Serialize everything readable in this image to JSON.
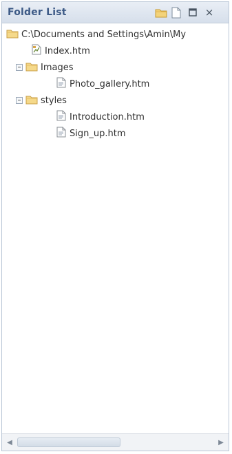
{
  "panel": {
    "title": "Folder List",
    "toolbar_icons": [
      "new-folder-icon",
      "new-page-icon",
      "maximize-icon",
      "close-icon"
    ],
    "close_glyph": "×"
  },
  "tree": {
    "root": {
      "label": "C:\\Documents and Settings\\Amin\\My",
      "icon": "folder-icon"
    },
    "items": [
      {
        "label": "Index.htm",
        "icon": "home-page-icon"
      },
      {
        "label": "Images",
        "icon": "folder-icon",
        "expanded": true
      },
      {
        "label": "Photo_gallery.htm",
        "icon": "page-icon"
      },
      {
        "label": "styles",
        "icon": "folder-icon",
        "expanded": true
      },
      {
        "label": "Introduction.htm",
        "icon": "page-icon"
      },
      {
        "label": "Sign_up.htm",
        "icon": "page-icon"
      }
    ]
  },
  "scrollbar": {
    "left_arrow": "◀",
    "right_arrow": "▶",
    "position": 0
  }
}
